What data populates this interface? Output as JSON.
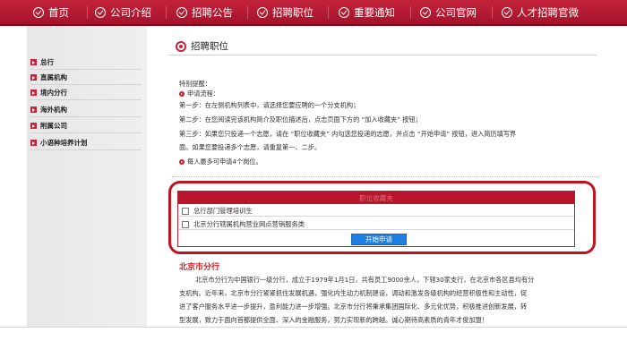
{
  "nav": {
    "items": [
      "首页",
      "公司介绍",
      "招聘公告",
      "招聘职位",
      "重要通知",
      "公司官网",
      "人才招聘官微"
    ]
  },
  "sidebar": {
    "items": [
      "总行",
      "直属机构",
      "境内分行",
      "海外机构",
      "附属公司",
      "小语种培养计划"
    ]
  },
  "main": {
    "title": "招聘职位",
    "notice_label": "特别提醒：",
    "process_label": "申请流程：",
    "steps": [
      "第一步：在左侧机构列表中，请选择您要应聘的一个分支机构；",
      "第二步：在您阅读完该机构简介及职位描述后，点击页面下方的 “加入收藏夹” 按钮；",
      "第三步：如果您只投递一个志愿，请在 “职位收藏夹” 内勾选您投递的志愿，并点击 “开始申请” 按钮，进入简历填写界",
      "面。如果您要投递多个志愿，请重复第一、二步。"
    ],
    "limit_note": "每人最多可申请4个岗位。"
  },
  "favorites": {
    "header": "职位收藏夹",
    "rows": [
      "总行部门管理培训生",
      "北京分行辖属机构营业网点营销服务类"
    ],
    "start_button": "开始申请"
  },
  "branch": {
    "title": "北京市分行",
    "lines": [
      "北京市分行为中国银行一级分行，成立于1979年1月1日，共有员工9000余人，下辖30家支行，在北京市各区县均有分",
      "支机构。近年来，北京市分行紧紧抓住发展机遇，强化内生动力机制建设，调动和激发各级机构的经营积极性和主动性，促",
      "进了客户服务水平进一步提升，盈利能力进一步增强。北京市分行将秉承集团国际化、多元化优势，积极推进创新发展，转",
      "型发展，致力于面向首都提供全面、深入的金融服务，努力实现新的跨越。诚心期待高素质的青年才俊加盟！"
    ]
  },
  "colors": {
    "brand_red": "#c4243c",
    "callout_red": "#c0121f",
    "button_blue": "#1e7fe0"
  }
}
